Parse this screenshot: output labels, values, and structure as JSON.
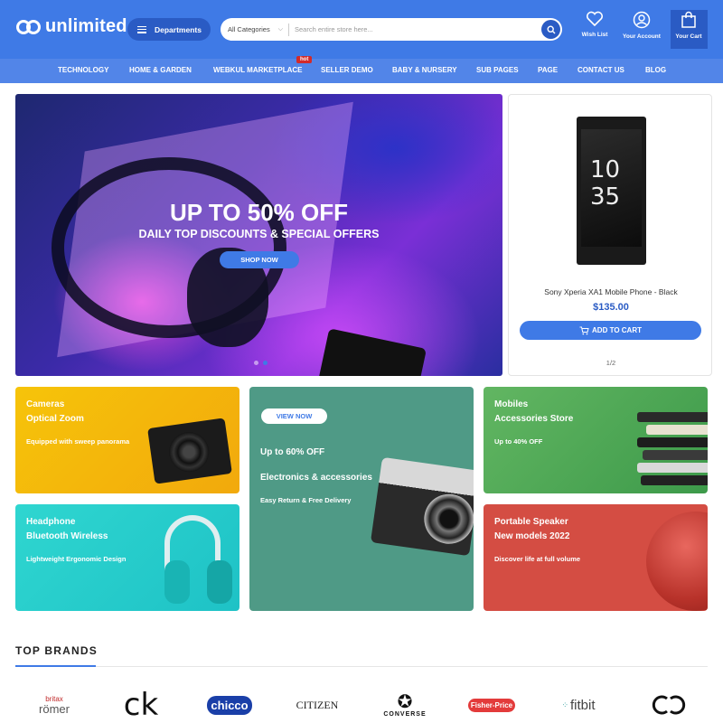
{
  "header": {
    "logo_text": "unlimited",
    "departments_label": "Departments",
    "search_category": "All Categories",
    "search_placeholder": "Search entire store here...",
    "wishlist_label": "Wish List",
    "account_label": "Your Account",
    "cart_label": "Your Cart"
  },
  "nav": {
    "items": [
      "TECHNOLOGY",
      "HOME & GARDEN",
      "WEBKUL MARKETPLACE",
      "SELLER DEMO",
      "BABY & NURSERY",
      "SUB PAGES",
      "PAGE",
      "CONTACT US",
      "BLOG"
    ],
    "hot_badge": "hot"
  },
  "hero": {
    "title": "UP TO 50% OFF",
    "subtitle": "DAILY TOP DISCOUNTS & SPECIAL OFFERS",
    "button": "SHOP NOW",
    "slide_count": 2,
    "active_slide": 2
  },
  "product": {
    "device_brand": "SONY",
    "device_clock": "10 35",
    "name": "Sony Xperia XA1 Mobile Phone - Black",
    "price": "$135.00",
    "button": "ADD TO CART",
    "pager": "1/2"
  },
  "promos": {
    "cameras": {
      "line1": "Cameras",
      "line2": "Optical Zoom",
      "desc": "Equipped with sweep panorama"
    },
    "headphone": {
      "line1": "Headphone",
      "line2": "Bluetooth Wireless",
      "desc": "Lightweight Ergonomic Design"
    },
    "electronics": {
      "button": "VIEW NOW",
      "line1": "Up to 60% OFF",
      "line2": "Electronics & accessories",
      "desc": "Easy Return & Free Delivery"
    },
    "mobiles": {
      "line1": "Mobiles",
      "line2": "Accessories Store",
      "desc": "Up to 40% OFF"
    },
    "speaker": {
      "line1": "Portable Speaker",
      "line2": "New models 2022",
      "desc": "Discover life at full volume"
    }
  },
  "brands": {
    "title": "TOP BRANDS",
    "items": [
      {
        "top": "britax",
        "bottom": "römer"
      },
      {
        "top": "ck"
      },
      {
        "top": "chicco"
      },
      {
        "top": "CITIZEN"
      },
      {
        "top": "CONVERSE"
      },
      {
        "top": "Fisher-Price"
      },
      {
        "top": "fitbit"
      },
      {
        "top": "GG"
      }
    ]
  },
  "colors": {
    "primary": "#3f7ae6",
    "primary_dark": "#2a5bc4",
    "price": "#2a5bc4",
    "hot": "#d32a2a"
  }
}
